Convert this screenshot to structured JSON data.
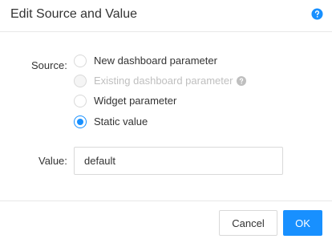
{
  "dialog": {
    "title": "Edit Source and Value",
    "help_icon": "question-circle-icon"
  },
  "source": {
    "label": "Source",
    "options": [
      {
        "label": "New dashboard parameter",
        "checked": false,
        "disabled": false
      },
      {
        "label": "Existing dashboard parameter",
        "checked": false,
        "disabled": true
      },
      {
        "label": "Widget parameter",
        "checked": false,
        "disabled": false
      },
      {
        "label": "Static value",
        "checked": true,
        "disabled": false
      }
    ]
  },
  "value": {
    "label": "Value",
    "current": "default"
  },
  "footer": {
    "cancel_label": "Cancel",
    "ok_label": "OK"
  },
  "colors": {
    "accent": "#1890ff",
    "border": "#d9d9d9",
    "disabled_text": "#bfbfbf"
  }
}
